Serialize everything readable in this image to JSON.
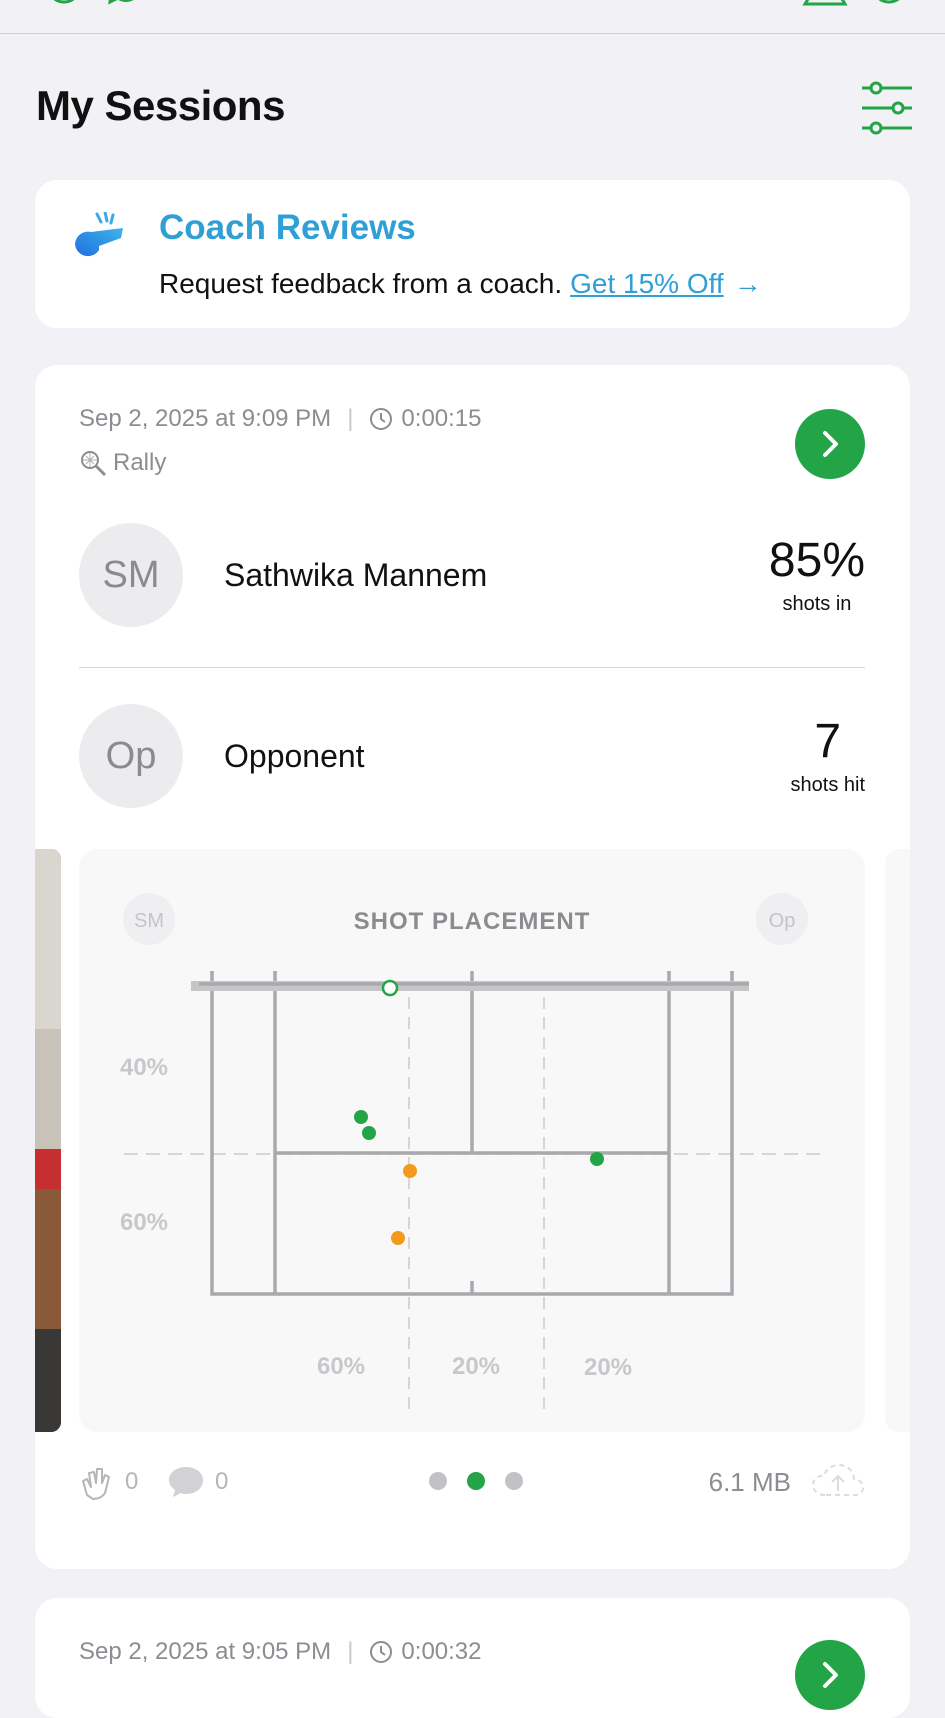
{
  "page": {
    "title": "My Sessions"
  },
  "coach": {
    "title": "Coach Reviews",
    "subtitle": "Request feedback from a coach.",
    "link": "Get 15% Off",
    "arrow": "→"
  },
  "colors": {
    "accent_green": "#22a447",
    "link_blue": "#2f9fd6",
    "orange": "#f39a1c",
    "court_line": "#a9a9ad"
  },
  "icons": [
    "filter-sliders-icon",
    "whistle-icon",
    "clock-icon",
    "racket-icon",
    "chevron-right-icon",
    "clap-icon",
    "comment-icon",
    "cloud-upload-icon"
  ],
  "sessions": [
    {
      "date": "Sep 2, 2025 at 9:09 PM",
      "duration": "0:00:15",
      "type": "Rally",
      "players": [
        {
          "initials": "SM",
          "name": "Sathwika Mannem",
          "stat_value": "85%",
          "stat_label": "shots in"
        },
        {
          "initials": "Op",
          "name": "Opponent",
          "stat_value": "7",
          "stat_label": "shots hit"
        }
      ],
      "chart": {
        "title": "SHOT PLACEMENT",
        "left_badge": "SM",
        "right_badge": "Op",
        "depth_labels": [
          "40%",
          "60%"
        ],
        "width_labels": [
          "60%",
          "20%",
          "20%"
        ],
        "player_shots": "green",
        "opponent_shots": "orange"
      },
      "claps": "0",
      "comments": "0",
      "pager": {
        "count": 3,
        "active": 2
      },
      "size": "6.1 MB"
    },
    {
      "date": "Sep 2, 2025 at 9:05 PM",
      "duration": "0:00:32"
    }
  ]
}
